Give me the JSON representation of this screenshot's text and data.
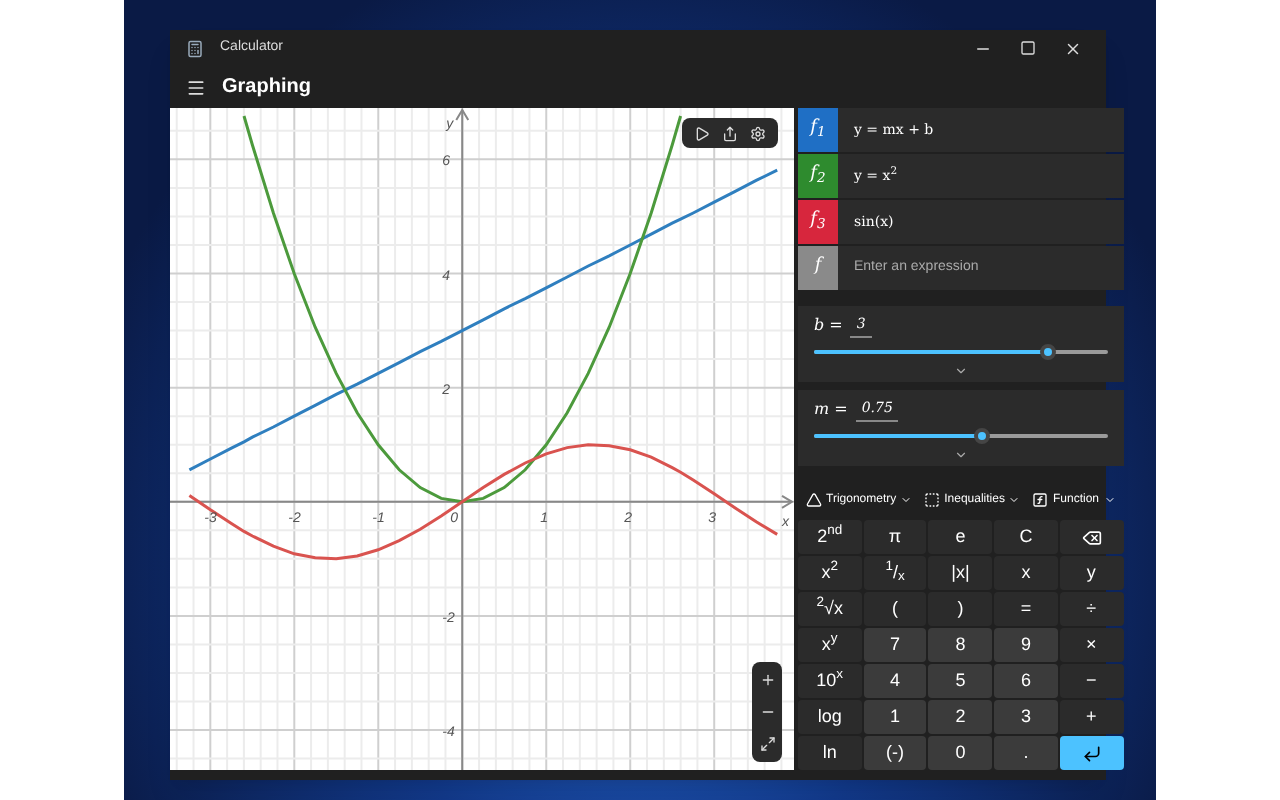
{
  "window": {
    "title": "Calculator"
  },
  "header": {
    "title": "Graphing"
  },
  "graph": {
    "chart_data": {
      "type": "line",
      "xlabel": "x",
      "ylabel": "y",
      "grid": true,
      "x": [
        -3.25,
        -3,
        -2.75,
        -2.6,
        -2.5,
        -2.25,
        -2,
        -1.75,
        -1.5,
        -1.25,
        -1,
        -0.75,
        -0.5,
        -0.25,
        0,
        0.25,
        0.5,
        0.75,
        1,
        1.25,
        1.5,
        1.75,
        2,
        2.25,
        2.5,
        2.6,
        2.75,
        3,
        3.25,
        3.5,
        3.75
      ],
      "series": [
        {
          "color": "#2f7fbf",
          "values": [
            0.56,
            0.75,
            0.94,
            1.05,
            1.13,
            1.31,
            1.5,
            1.69,
            1.88,
            2.06,
            2.25,
            2.44,
            2.63,
            2.81,
            3,
            3.19,
            3.38,
            3.56,
            3.75,
            3.94,
            4.13,
            4.31,
            4.5,
            4.69,
            4.88,
            4.95,
            5.06,
            5.25,
            5.44,
            5.63,
            5.81
          ]
        },
        {
          "color": "#4c9a3c",
          "values": [
            null,
            null,
            null,
            6.76,
            6.25,
            5.06,
            4,
            3.06,
            2.25,
            1.56,
            1,
            0.56,
            0.25,
            0.06,
            0,
            0.06,
            0.25,
            0.56,
            1,
            1.56,
            2.25,
            3.06,
            4,
            5.06,
            6.25,
            6.76,
            null,
            null,
            null,
            null,
            null
          ]
        },
        {
          "color": "#d9534f",
          "values": [
            0.11,
            -0.14,
            -0.38,
            -0.52,
            -0.6,
            -0.78,
            -0.91,
            -0.98,
            -1,
            -0.95,
            -0.84,
            -0.68,
            -0.48,
            -0.25,
            0,
            0.25,
            0.48,
            0.68,
            0.84,
            0.95,
            1,
            0.98,
            0.91,
            0.78,
            0.6,
            0.52,
            0.38,
            0.14,
            -0.11,
            -0.35,
            -0.57
          ]
        }
      ],
      "xlim": [
        -3.48,
        3.95
      ],
      "ylim": [
        -4.7,
        6.9
      ],
      "xticks": [
        -3,
        -2,
        -1,
        0,
        1,
        2,
        3
      ],
      "yticks": [
        -4,
        -2,
        2,
        4,
        6
      ]
    }
  },
  "expressions": [
    {
      "symbol": "f$_{1}$",
      "text": "y = mx + b",
      "color": "#1f6fc5"
    },
    {
      "symbol": "f$_{2}$",
      "text": "y = x$^{2}$",
      "color": "#2e8b2e"
    },
    {
      "symbol": "f$_{3}$",
      "text": "sin(x)",
      "color": "#d7263d"
    },
    {
      "symbol": "f",
      "placeholder": "Enter an expression",
      "color": "#8a8a8a"
    }
  ],
  "variables": [
    {
      "label": "b =",
      "value": "3",
      "level": 0.8
    },
    {
      "label": "m =",
      "value": "0.75",
      "level": 0.57
    }
  ],
  "toolbar": [
    {
      "label": "Trigonometry",
      "kind": "trig"
    },
    {
      "label": "Inequalities",
      "kind": "ineq"
    },
    {
      "label": "Function",
      "kind": "func"
    }
  ],
  "keypad": [
    {
      "label": "2$^{nd}$",
      "kind": "op"
    },
    {
      "label": "π",
      "kind": "op"
    },
    {
      "label": "e",
      "kind": "op"
    },
    {
      "label": "C",
      "kind": "op"
    },
    {
      "kind": "backspace"
    },
    {
      "label": "x$^{2}$",
      "kind": "op"
    },
    {
      "label": "$^{1}$/$_{x}$",
      "kind": "op"
    },
    {
      "label": "|x|",
      "kind": "op"
    },
    {
      "label": "x",
      "kind": "op"
    },
    {
      "label": "y",
      "kind": "op"
    },
    {
      "label": "$^{2}$√x",
      "kind": "op"
    },
    {
      "label": "(",
      "kind": "op"
    },
    {
      "label": ")",
      "kind": "op"
    },
    {
      "label": "=",
      "kind": "op"
    },
    {
      "label": "÷",
      "kind": "op"
    },
    {
      "label": "x$^{y}$",
      "kind": "op"
    },
    {
      "label": "7",
      "kind": "num"
    },
    {
      "label": "8",
      "kind": "num"
    },
    {
      "label": "9",
      "kind": "num"
    },
    {
      "label": "×",
      "kind": "op"
    },
    {
      "label": "10$^{x}$",
      "kind": "op"
    },
    {
      "label": "4",
      "kind": "num"
    },
    {
      "label": "5",
      "kind": "num"
    },
    {
      "label": "6",
      "kind": "num"
    },
    {
      "label": "−",
      "kind": "op"
    },
    {
      "label": "log",
      "kind": "op"
    },
    {
      "label": "1",
      "kind": "num"
    },
    {
      "label": "2",
      "kind": "num"
    },
    {
      "label": "3",
      "kind": "num"
    },
    {
      "label": "+",
      "kind": "op"
    },
    {
      "label": "ln",
      "kind": "op"
    },
    {
      "label": "(-)",
      "kind": "num"
    },
    {
      "label": "0",
      "kind": "num"
    },
    {
      "label": ".",
      "kind": "num"
    },
    {
      "kind": "enter"
    }
  ]
}
